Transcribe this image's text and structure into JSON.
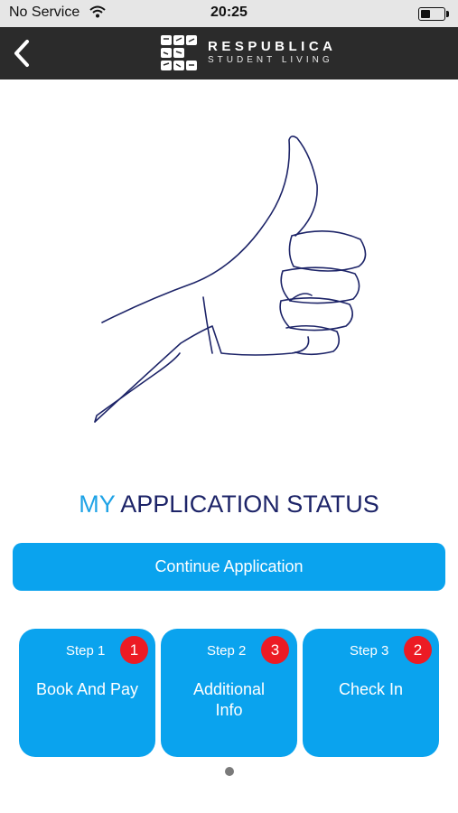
{
  "status_bar": {
    "carrier": "No Service",
    "time": "20:25",
    "battery_level": 0.4
  },
  "nav": {
    "back_icon": "chevron-left-icon",
    "logo_title": "RESPUBLICA",
    "logo_subtitle": "STUDENT LIVING"
  },
  "page": {
    "title_accent": "MY",
    "title_rest": " APPLICATION STATUS",
    "continue_label": "Continue Application",
    "accent_color": "#1fa3e6",
    "button_color": "#0aa3ee",
    "badge_color": "#ec1b24"
  },
  "steps": [
    {
      "number": "Step 1",
      "badge": "1",
      "label": "Book And Pay"
    },
    {
      "number": "Step 2",
      "badge": "3",
      "label": "Additional Info"
    },
    {
      "number": "Step 3",
      "badge": "2",
      "label": "Check In"
    }
  ],
  "pager": {
    "pages": 1,
    "current": 1
  }
}
